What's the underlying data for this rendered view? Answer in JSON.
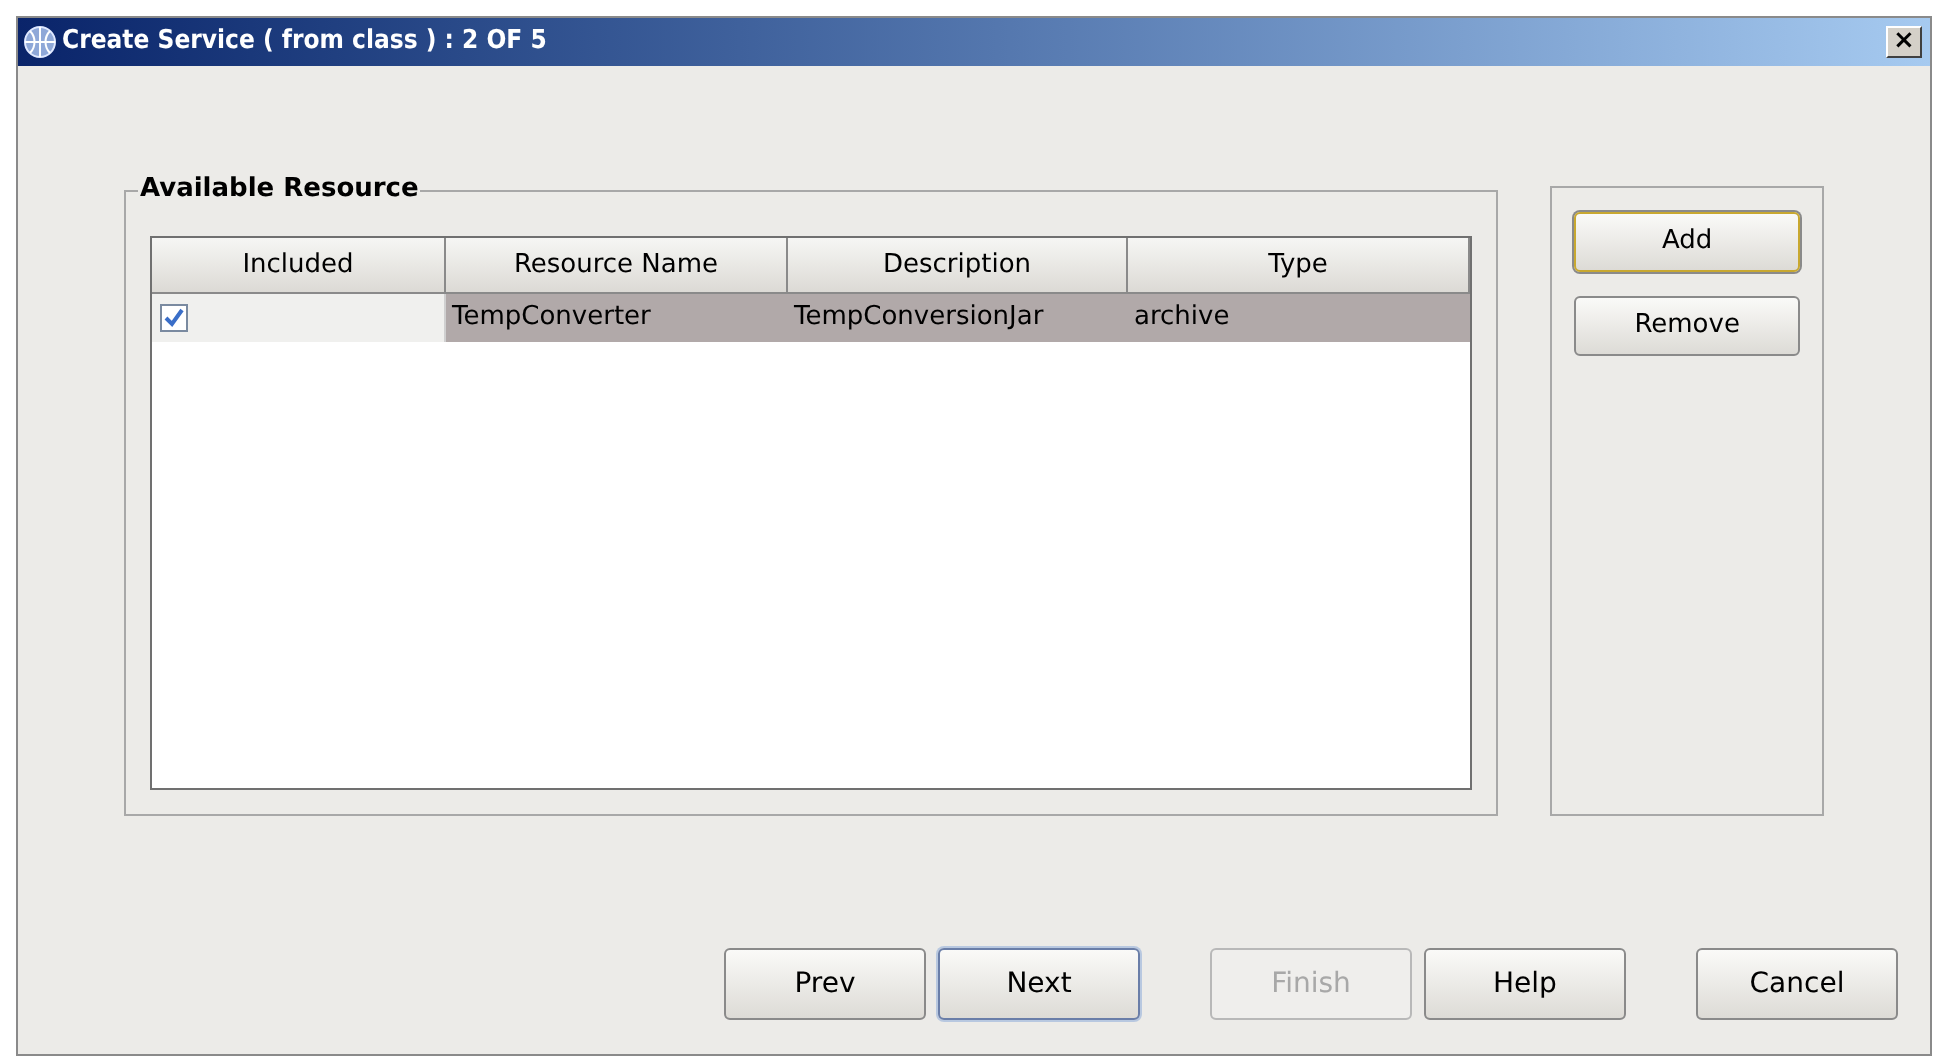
{
  "window": {
    "title": "Create Service ( from class ) : 2 OF 5",
    "close": "×"
  },
  "group": {
    "title": "Available Resource"
  },
  "table": {
    "columns": [
      "Included",
      "Resource Name",
      "Description",
      "Type"
    ],
    "rows": [
      {
        "selected": true,
        "cells": [
          {
            "kind": "checkbox",
            "checked": true
          },
          {
            "kind": "text",
            "text": "TempConverter"
          },
          {
            "kind": "text",
            "text": "TempConversionJar"
          },
          {
            "kind": "text",
            "text": "archive"
          }
        ]
      }
    ]
  },
  "side_buttons": [
    {
      "label": "Add",
      "focused": true
    },
    {
      "label": "Remove",
      "focused": false
    }
  ],
  "buttons": [
    {
      "label": "Prev",
      "default": false,
      "disabled": false
    },
    {
      "label": "Next",
      "default": true,
      "disabled": false
    },
    {
      "label": "Finish",
      "default": false,
      "disabled": true
    },
    {
      "label": "Help",
      "default": false,
      "disabled": false
    },
    {
      "label": "Cancel",
      "default": false,
      "disabled": false
    }
  ]
}
